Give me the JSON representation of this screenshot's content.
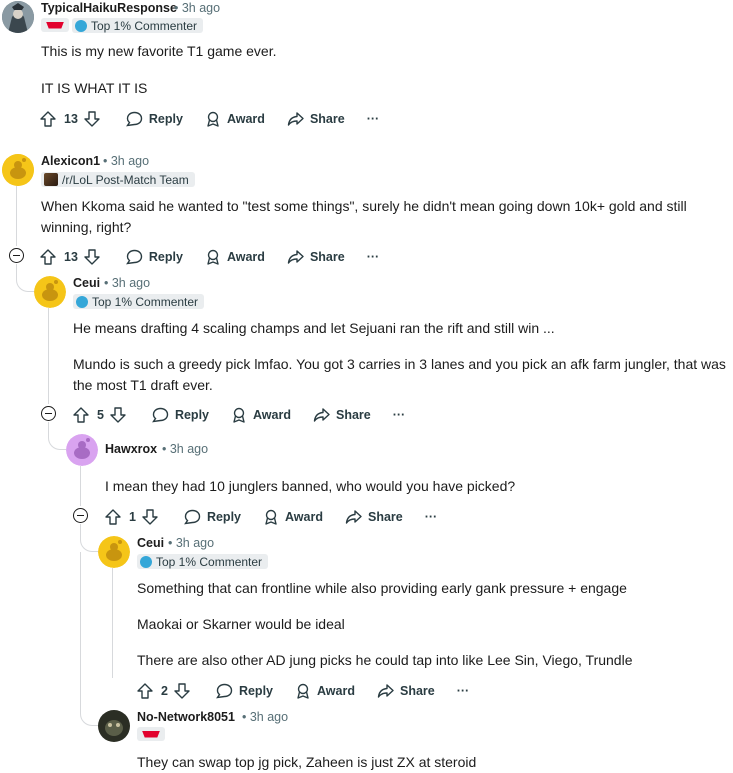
{
  "comments": [
    {
      "author": "TypicalHaikuResponse",
      "time": "• 3h ago",
      "flair": "Top 1% Commenter",
      "body": [
        "This is my new favorite T1 game ever.",
        "IT IS WHAT IT IS"
      ],
      "votes": "13"
    },
    {
      "author": "Alexicon1",
      "time": "• 3h ago",
      "flair": "/r/LoL Post-Match Team",
      "body": [
        "When Kkoma said he wanted to \"test some things\", surely he didn't mean going down 10k+ gold and still",
        "winning, right?"
      ],
      "votes": "13"
    },
    {
      "author": "Ceui",
      "time": "• 3h ago",
      "flair": "Top 1% Commenter",
      "body": [
        "He means drafting 4 scaling champs and let Sejuani ran the rift and still win ...",
        "Mundo is such a greedy pick lmfao. You got 3 carries in 3 lanes and you pick an afk farm jungler, that was",
        "the most T1 draft ever."
      ],
      "votes": "5"
    },
    {
      "author": "Hawxrox",
      "time": "• 3h ago",
      "body": [
        "I mean they had 10 junglers banned, who would you have picked?"
      ],
      "votes": "1"
    },
    {
      "author": "Ceui",
      "time": "• 3h ago",
      "flair": "Top 1% Commenter",
      "body": [
        "Something that can frontline while also providing early gank pressure + engage",
        "Maokai or Skarner would be ideal",
        "There are also other AD jung picks he could tap into like Lee Sin, Viego, Trundle"
      ],
      "votes": "2"
    },
    {
      "author": "No-Network8051",
      "time": "• 3h ago",
      "body": [
        "They can swap top jg pick, Zaheen is just ZX at steroid"
      ]
    }
  ],
  "actions": {
    "reply": "Reply",
    "award": "Award",
    "share": "Share",
    "more": "···"
  },
  "icons": [
    "upvote-icon",
    "downvote-icon",
    "reply-icon",
    "award-icon",
    "share-icon",
    "more-icon",
    "collapse-icon"
  ],
  "colors": {
    "snoo_yellow": "#f5c518",
    "snoo_purple": "#d9a3f0",
    "t1_red": "#e2012d",
    "thread_line": "#d7d9dc",
    "flair_bg": "#eaedef"
  }
}
